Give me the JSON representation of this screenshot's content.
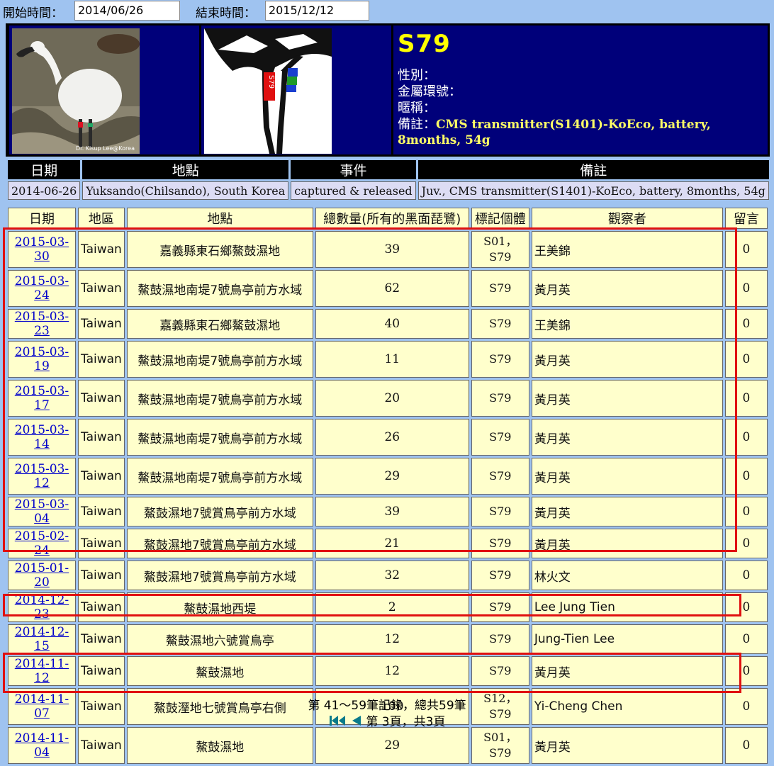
{
  "filters": {
    "start_label": "開始時間：",
    "start_value": "2014/06/26",
    "end_label": "結束時間：",
    "end_value": "2015/12/12"
  },
  "bird": {
    "band_id": "S79",
    "photo_credit": "Dr. Kisup Lee@Korea",
    "diagram_band_text": "S79",
    "sex_label": "性別：",
    "sex_value": "",
    "metal_label": "金屬環號：",
    "metal_value": "",
    "nickname_label": "暱稱：",
    "nickname_value": "",
    "note_label": "備註：",
    "note_value": "CMS transmitter(S1401)-KoEco, battery, 8months, 54g"
  },
  "events": {
    "headers": [
      "日期",
      "地點",
      "事件",
      "備註"
    ],
    "rows": [
      [
        "2014-06-26",
        "Yuksando(Chilsando), South Korea",
        "captured & released",
        "Juv., CMS transmitter(S1401)-KoEco, battery, 8months, 54g"
      ]
    ]
  },
  "observations": {
    "headers": [
      "日期",
      "地區",
      "地點",
      "總數量(所有的黑面琵鷺)",
      "標記個體",
      "觀察者",
      "留言"
    ],
    "rows": [
      {
        "date": "2015-03-30",
        "region": "Taiwan",
        "place": "嘉義縣東石鄉鰲鼓濕地",
        "count": "39",
        "marked": "S01，S79",
        "observer": "王美錦",
        "comments": "0"
      },
      {
        "date": "2015-03-24",
        "region": "Taiwan",
        "place": "鰲鼓濕地南堤7號鳥亭前方水域",
        "count": "62",
        "marked": "S79",
        "observer": "黃月英",
        "comments": "0"
      },
      {
        "date": "2015-03-23",
        "region": "Taiwan",
        "place": "嘉義縣東石鄉鰲鼓濕地",
        "count": "40",
        "marked": "S79",
        "observer": "王美錦",
        "comments": "0"
      },
      {
        "date": "2015-03-19",
        "region": "Taiwan",
        "place": "鰲鼓濕地南堤7號鳥亭前方水域",
        "count": "11",
        "marked": "S79",
        "observer": "黃月英",
        "comments": "0"
      },
      {
        "date": "2015-03-17",
        "region": "Taiwan",
        "place": "鰲鼓濕地南堤7號鳥亭前方水域",
        "count": "20",
        "marked": "S79",
        "observer": "黃月英",
        "comments": "0"
      },
      {
        "date": "2015-03-14",
        "region": "Taiwan",
        "place": "鰲鼓濕地南堤7號鳥亭前方水域",
        "count": "26",
        "marked": "S79",
        "observer": "黃月英",
        "comments": "0"
      },
      {
        "date": "2015-03-12",
        "region": "Taiwan",
        "place": "鰲鼓濕地南堤7號鳥亭前方水域",
        "count": "29",
        "marked": "S79",
        "observer": "黃月英",
        "comments": "0"
      },
      {
        "date": "2015-03-04",
        "region": "Taiwan",
        "place": "鰲鼓濕地7號賞鳥亭前方水域",
        "count": "39",
        "marked": "S79",
        "observer": "黃月英",
        "comments": "0"
      },
      {
        "date": "2015-02-24",
        "region": "Taiwan",
        "place": "鰲鼓濕地7號賞鳥亭前方水域",
        "count": "21",
        "marked": "S79",
        "observer": "黃月英",
        "comments": "0"
      },
      {
        "date": "2015-01-20",
        "region": "Taiwan",
        "place": "鰲鼓濕地7號賞鳥亭前方水域",
        "count": "32",
        "marked": "S79",
        "observer": "林火文",
        "comments": "0"
      },
      {
        "date": "2014-12-23",
        "region": "Taiwan",
        "place": "鰲鼓濕地西堤",
        "count": "2",
        "marked": "S79",
        "observer": "Lee Jung Tien",
        "comments": "0"
      },
      {
        "date": "2014-12-15",
        "region": "Taiwan",
        "place": "鰲鼓濕地六號賞鳥亭",
        "count": "12",
        "marked": "S79",
        "observer": "Jung-Tien Lee",
        "comments": "0"
      },
      {
        "date": "2014-11-12",
        "region": "Taiwan",
        "place": "鰲鼓濕地",
        "count": "12",
        "marked": "S79",
        "observer": "黃月英",
        "comments": "0"
      },
      {
        "date": "2014-11-07",
        "region": "Taiwan",
        "place": "鰲鼓溼地七號賞鳥亭右側",
        "count": "100",
        "marked": "S12，S79",
        "observer": "Yi-Cheng Chen",
        "comments": "0"
      },
      {
        "date": "2014-11-04",
        "region": "Taiwan",
        "place": "鰲鼓濕地",
        "count": "29",
        "marked": "S01，S79",
        "observer": "黃月英",
        "comments": "0"
      }
    ]
  },
  "footer": {
    "records_text": "第 41～59筆記錄，總共59筆",
    "page_text": "第 3頁，共3頁",
    "first_icon": "first-page-icon",
    "prev_icon": "prev-page-icon"
  },
  "colors": {
    "page_bg": "#9fc3f0",
    "panel_bg": "#00007a",
    "band_title": "#ffff00",
    "table_cell": "#ffffcc",
    "link": "#0000cc",
    "highlight": "#e01010"
  }
}
